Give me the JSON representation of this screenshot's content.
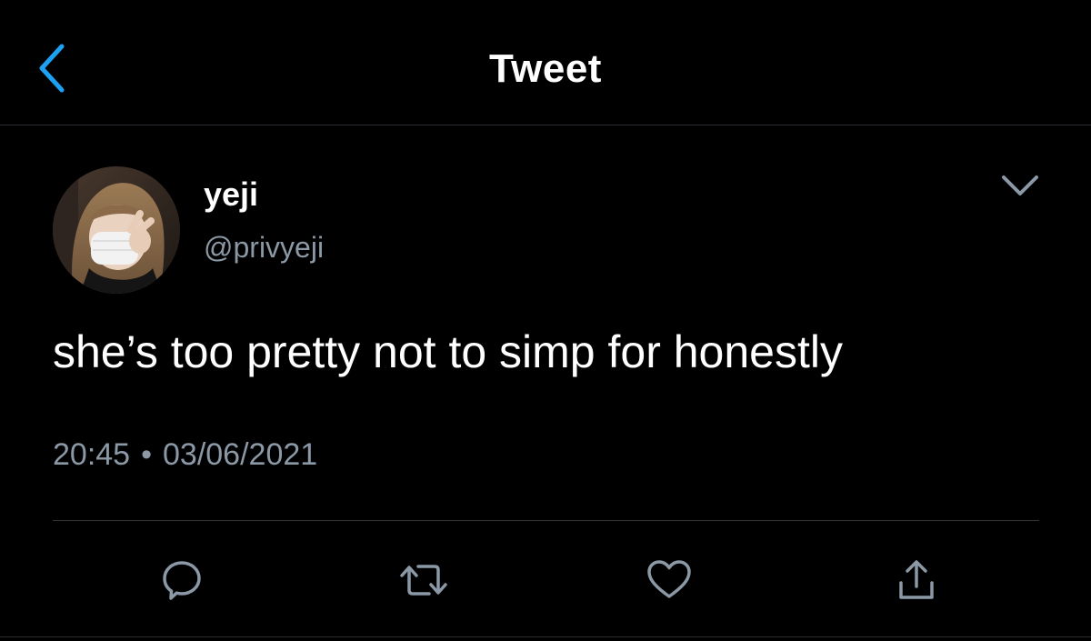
{
  "header": {
    "title": "Tweet",
    "back_icon": "chevron-left-icon"
  },
  "tweet": {
    "author": {
      "name": "yeji",
      "handle": "@privyeji",
      "avatar": "profile-photo"
    },
    "text": "she’s too pretty not to simp for honestly",
    "time": "20:45",
    "separator": "•",
    "date": "03/06/2021"
  },
  "actions": [
    {
      "name": "reply",
      "icon": "speech-bubble-icon"
    },
    {
      "name": "retweet",
      "icon": "retweet-icon"
    },
    {
      "name": "like",
      "icon": "heart-icon"
    },
    {
      "name": "share",
      "icon": "share-icon"
    }
  ],
  "colors": {
    "background": "#000000",
    "accent": "#1da1f2",
    "text_primary": "#ffffff",
    "text_secondary": "#8b98a5",
    "divider": "#2f3336"
  }
}
